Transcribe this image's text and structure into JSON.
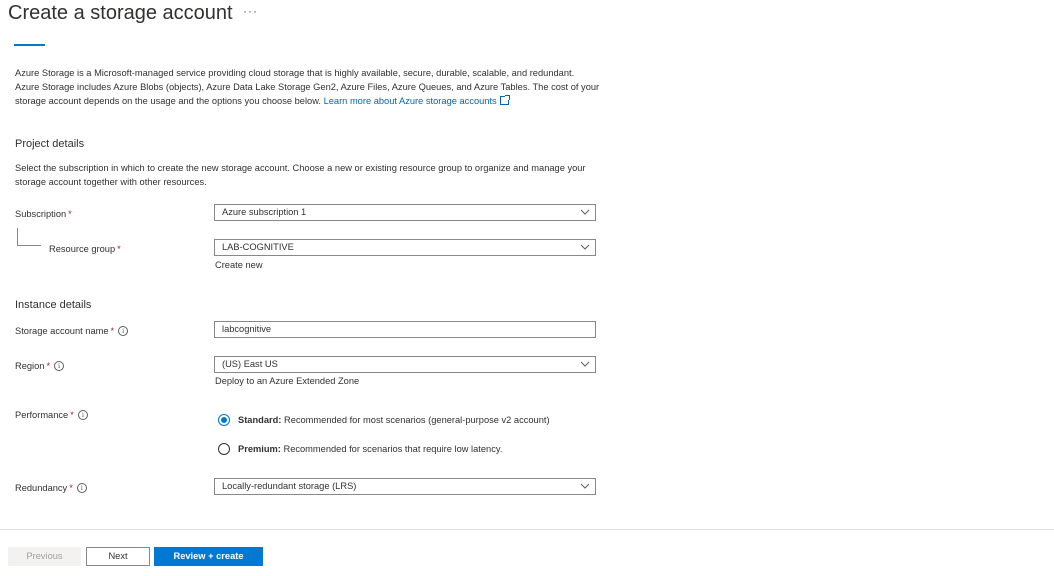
{
  "header": {
    "title": "Create a storage account",
    "more_label": "···"
  },
  "intro": {
    "text": "Azure Storage is a Microsoft-managed service providing cloud storage that is highly available, secure, durable, scalable, and redundant. Azure Storage includes Azure Blobs (objects), Azure Data Lake Storage Gen2, Azure Files, Azure Queues, and Azure Tables. The cost of your storage account depends on the usage and the options you choose below. ",
    "link": "Learn more about Azure storage accounts"
  },
  "project": {
    "heading": "Project details",
    "description": "Select the subscription in which to create the new storage account. Choose a new or existing resource group to organize and manage your storage account together with other resources.",
    "subscription_label": "Subscription",
    "subscription_value": "Azure subscription 1",
    "resource_group_label": "Resource group",
    "resource_group_value": "LAB-COGNITIVE",
    "create_new_link": "Create new"
  },
  "instance": {
    "heading": "Instance details",
    "name_label": "Storage account name",
    "name_value": "labcognitive",
    "region_label": "Region",
    "region_value": "(US) East US",
    "extended_zone_link": "Deploy to an Azure Extended Zone",
    "performance_label": "Performance",
    "performance_options": [
      {
        "title": "Standard:",
        "desc": " Recommended for most scenarios (general-purpose v2 account)",
        "selected": true
      },
      {
        "title": "Premium:",
        "desc": " Recommended for scenarios that require low latency.",
        "selected": false
      }
    ],
    "redundancy_label": "Redundancy",
    "redundancy_value": "Locally-redundant storage (LRS)"
  },
  "required_marker": "*",
  "info_glyph": "i",
  "footer": {
    "previous_label": "Previous",
    "next_label": "Next",
    "review_label": "Review + create"
  },
  "colors": {
    "accent": "#0078d4",
    "link": "#0066b8",
    "required": "#a4262c",
    "border": "#8a8886"
  }
}
